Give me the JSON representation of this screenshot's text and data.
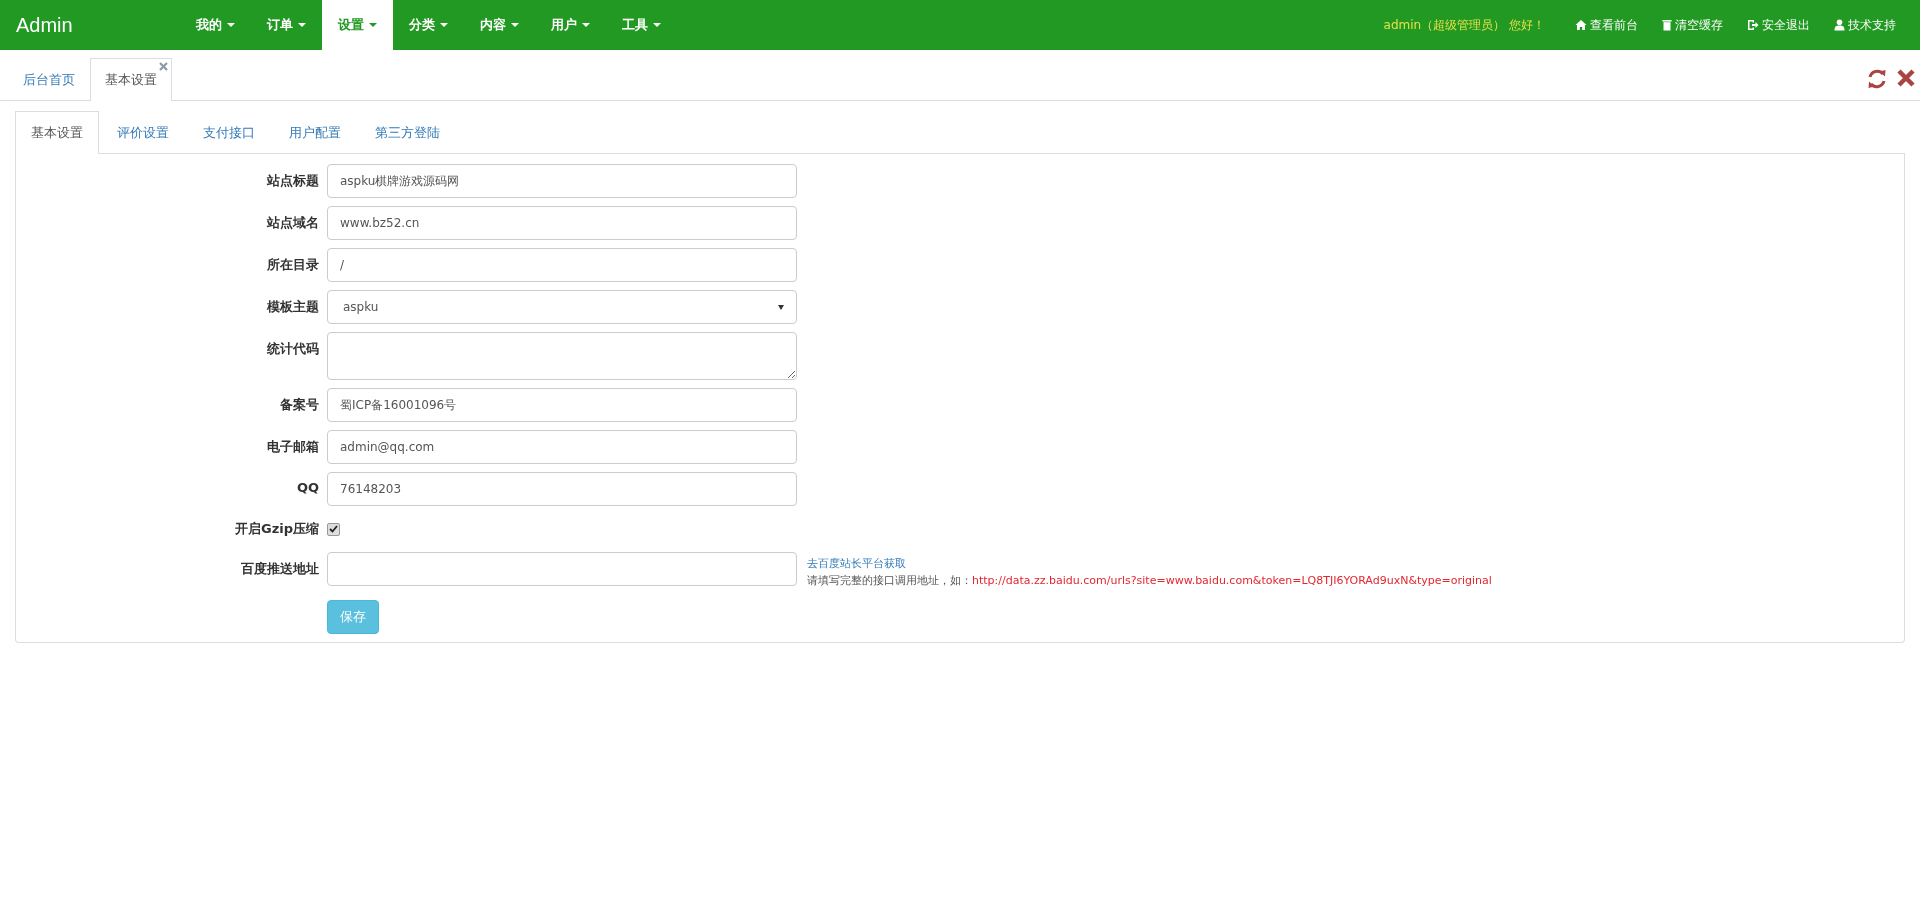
{
  "navbar": {
    "brand": "Admin",
    "menus": [
      {
        "label": "我的",
        "selected": false
      },
      {
        "label": "订单",
        "selected": false
      },
      {
        "label": "设置",
        "selected": true
      },
      {
        "label": "分类",
        "selected": false
      },
      {
        "label": "内容",
        "selected": false
      },
      {
        "label": "用户",
        "selected": false
      },
      {
        "label": "工具",
        "selected": false
      }
    ],
    "greeting": "admin（超级管理员） 您好！",
    "links": [
      {
        "kind": "home",
        "label": "查看前台"
      },
      {
        "kind": "trash",
        "label": "清空缓存"
      },
      {
        "kind": "logout",
        "label": "安全退出"
      },
      {
        "kind": "user",
        "label": "技术支持"
      }
    ]
  },
  "page_tabs": [
    {
      "label": "后台首页",
      "selected": false,
      "closable": false
    },
    {
      "label": "基本设置",
      "selected": true,
      "closable": true
    }
  ],
  "settings_tabs": [
    {
      "label": "基本设置",
      "selected": true
    },
    {
      "label": "评价设置",
      "selected": false
    },
    {
      "label": "支付接口",
      "selected": false
    },
    {
      "label": "用户配置",
      "selected": false
    },
    {
      "label": "第三方登陆",
      "selected": false
    }
  ],
  "form": {
    "fields": [
      {
        "kind": "text",
        "label": "站点标题",
        "value": "aspku棋牌游戏源码网"
      },
      {
        "kind": "text",
        "label": "站点域名",
        "value": "www.bz52.cn"
      },
      {
        "kind": "text",
        "label": "所在目录",
        "value": "/"
      },
      {
        "kind": "select",
        "label": "模板主题",
        "value": "aspku"
      },
      {
        "kind": "textarea",
        "label": "统计代码"
      },
      {
        "kind": "text",
        "label": "备案号",
        "value": "蜀ICP备16001096号"
      },
      {
        "kind": "text",
        "label": "电子邮箱",
        "value": "admin@qq.com"
      },
      {
        "kind": "text",
        "label": "QQ",
        "value": "76148203"
      },
      {
        "kind": "checkbox",
        "label": "开启Gzip压缩",
        "checked": true
      },
      {
        "kind": "text",
        "label": "百度推送地址",
        "help_link": "去百度站长平台获取",
        "help_text": "请填写完整的接口调用地址，如：",
        "help_example": "http://data.zz.baidu.com/urls?site=www.baidu.com&token=LQ8TJI6YORAd9uxN&type=original"
      }
    ],
    "save_button": "保存"
  }
}
